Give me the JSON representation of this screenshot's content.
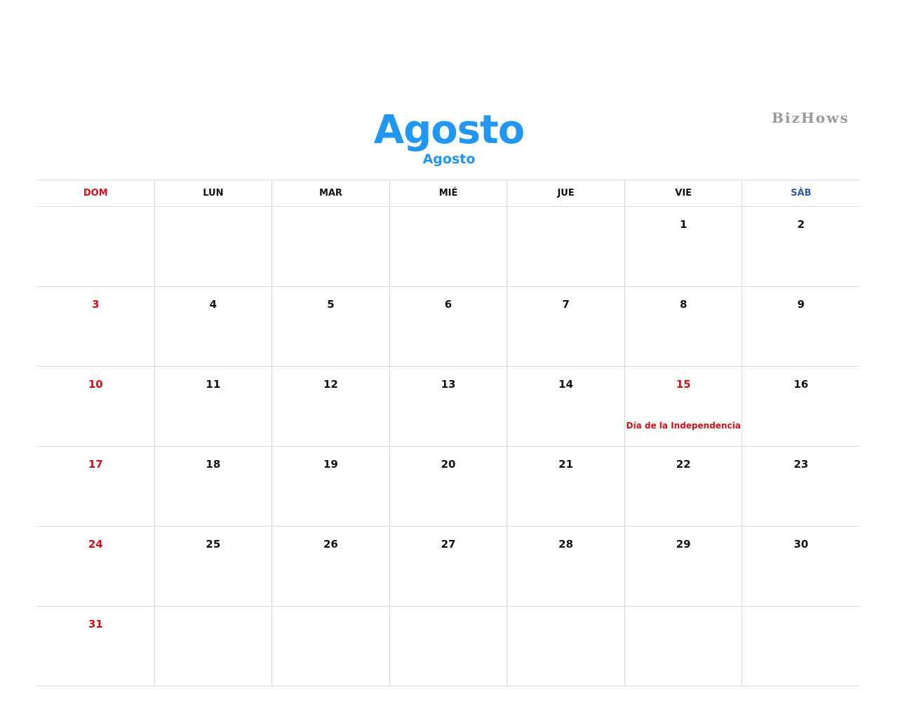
{
  "calendar": {
    "title": "Agosto",
    "subtitle": "Agosto",
    "brand": "BizHows",
    "colors": {
      "title": "#2196f3",
      "sunday": "#d0111b",
      "saturday": "#2e5aa8",
      "holiday": "#d0111b",
      "text": "#111111",
      "grid": "#dcd8e6"
    },
    "weekdays": [
      {
        "label": "DOM",
        "kind": "sunday"
      },
      {
        "label": "LUN",
        "kind": "weekday"
      },
      {
        "label": "MAR",
        "kind": "weekday"
      },
      {
        "label": "MIÉ",
        "kind": "weekday"
      },
      {
        "label": "JUE",
        "kind": "weekday"
      },
      {
        "label": "VIE",
        "kind": "weekday"
      },
      {
        "label": "SÁB",
        "kind": "saturday"
      }
    ],
    "weeks": [
      [
        {
          "day": ""
        },
        {
          "day": ""
        },
        {
          "day": ""
        },
        {
          "day": ""
        },
        {
          "day": ""
        },
        {
          "day": "1"
        },
        {
          "day": "2"
        }
      ],
      [
        {
          "day": "3",
          "red": true
        },
        {
          "day": "4"
        },
        {
          "day": "5"
        },
        {
          "day": "6"
        },
        {
          "day": "7"
        },
        {
          "day": "8"
        },
        {
          "day": "9"
        }
      ],
      [
        {
          "day": "10",
          "red": true
        },
        {
          "day": "11"
        },
        {
          "day": "12"
        },
        {
          "day": "13"
        },
        {
          "day": "14"
        },
        {
          "day": "15",
          "red": true,
          "note": "Día de la Independencia"
        },
        {
          "day": "16"
        }
      ],
      [
        {
          "day": "17",
          "red": true
        },
        {
          "day": "18"
        },
        {
          "day": "19"
        },
        {
          "day": "20"
        },
        {
          "day": "21"
        },
        {
          "day": "22"
        },
        {
          "day": "23"
        }
      ],
      [
        {
          "day": "24",
          "red": true
        },
        {
          "day": "25"
        },
        {
          "day": "26"
        },
        {
          "day": "27"
        },
        {
          "day": "28"
        },
        {
          "day": "29"
        },
        {
          "day": "30"
        }
      ],
      [
        {
          "day": "31",
          "red": true
        },
        {
          "day": ""
        },
        {
          "day": ""
        },
        {
          "day": ""
        },
        {
          "day": ""
        },
        {
          "day": ""
        },
        {
          "day": ""
        }
      ]
    ]
  }
}
